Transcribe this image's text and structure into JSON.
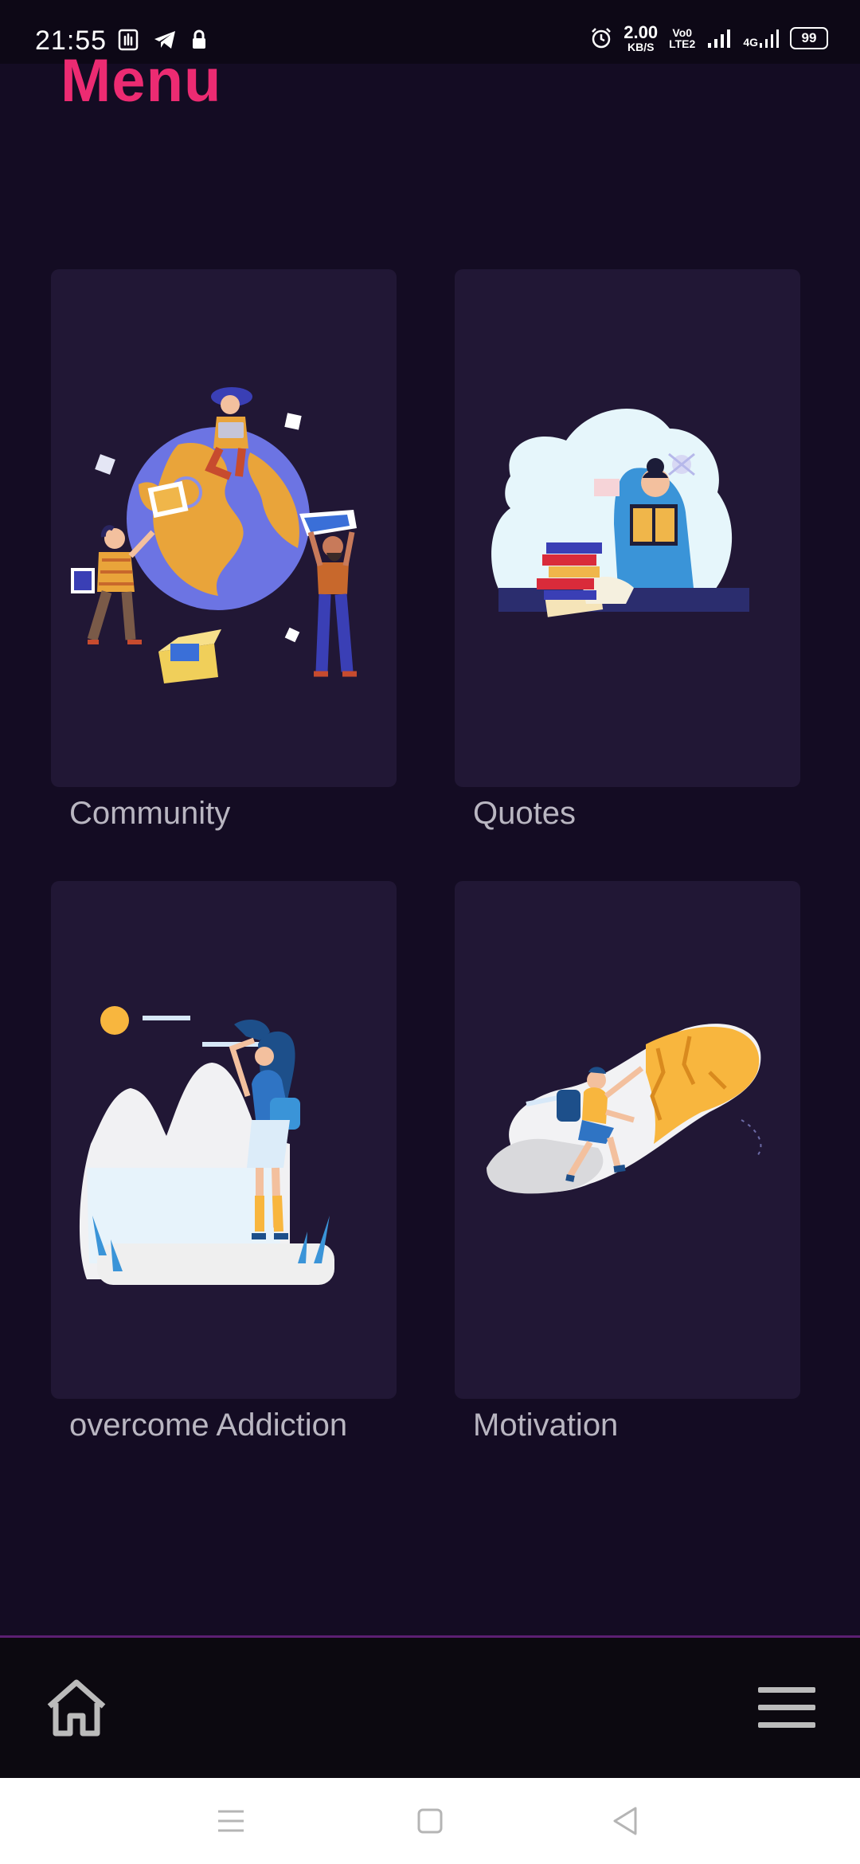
{
  "status_bar": {
    "time": "21:55",
    "speed_value": "2.00",
    "speed_unit": "KB/S",
    "volte_top": "Vo0",
    "volte_bottom": "LTE2",
    "network": "4G",
    "battery": "99"
  },
  "page": {
    "title": "Menu"
  },
  "cards": [
    {
      "label": "Community",
      "illustration": "community-globe-illustration"
    },
    {
      "label": "Quotes",
      "illustration": "reading-quotes-illustration"
    },
    {
      "label": "overcome Addiction",
      "illustration": "hiker-mountains-illustration"
    },
    {
      "label": "Motivation",
      "illustration": "rock-climber-illustration"
    }
  ],
  "bottom_nav": {
    "home_icon": "home-icon",
    "menu_icon": "hamburger-menu-icon"
  },
  "system_nav": {
    "icons": [
      "recent-apps-icon",
      "home-square-icon",
      "back-triangle-icon"
    ]
  },
  "colors": {
    "background": "#140c23",
    "card": "#211735",
    "title_accent": "#ec2b72",
    "label": "#b9b6c1",
    "divider": "#5c1f72"
  }
}
